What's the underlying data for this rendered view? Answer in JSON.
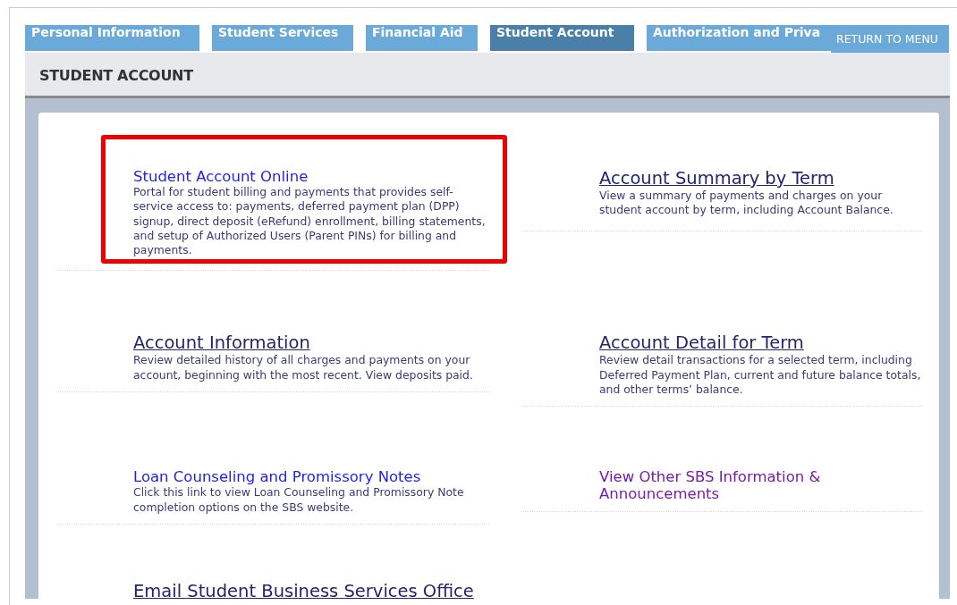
{
  "tabs": [
    {
      "label": "Personal Information",
      "selected": false
    },
    {
      "label": "Student Services",
      "selected": false
    },
    {
      "label": "Financial Aid",
      "selected": false
    },
    {
      "label": "Student Account",
      "selected": true
    },
    {
      "label": "Authorization and Priva",
      "selected": false
    }
  ],
  "return_link": "RETURN TO MENU",
  "page_title": "STUDENT ACCOUNT",
  "items": [
    {
      "kind": "link",
      "title": "Student Account Online",
      "description": "Portal for student billing and payments that provides self-service access to: payments, deferred payment plan (DPP) signup, direct deposit (eRefund) enrollment, billing statements, and setup of Authorized Users (Parent PINs) for billing and payments.",
      "highlighted": true
    },
    {
      "kind": "heading-link",
      "title": "Account Summary by Term",
      "description": "View a summary of payments and charges on your student account by term, including Account Balance.",
      "highlighted": false
    },
    {
      "kind": "heading-link",
      "title": "Account Information",
      "description": "Review detailed history of all charges and payments on your account, beginning with the most recent. View deposits paid.",
      "highlighted": false
    },
    {
      "kind": "heading-link",
      "title": "Account Detail for Term",
      "description": "Review detail transactions for a selected term, including Deferred Payment Plan, current and future balance totals, and other terms’ balance.",
      "highlighted": false
    },
    {
      "kind": "link",
      "title": "Loan Counseling and Promissory Notes",
      "description": "Click this link to view Loan Counseling and Promissory Note completion options on the SBS website.",
      "highlighted": false
    },
    {
      "kind": "visited-link",
      "title": "View Other SBS Information & Announcements",
      "highlighted": false
    },
    {
      "kind": "heading-link",
      "title": "Email Student Business Services Office",
      "highlighted": false
    }
  ]
}
